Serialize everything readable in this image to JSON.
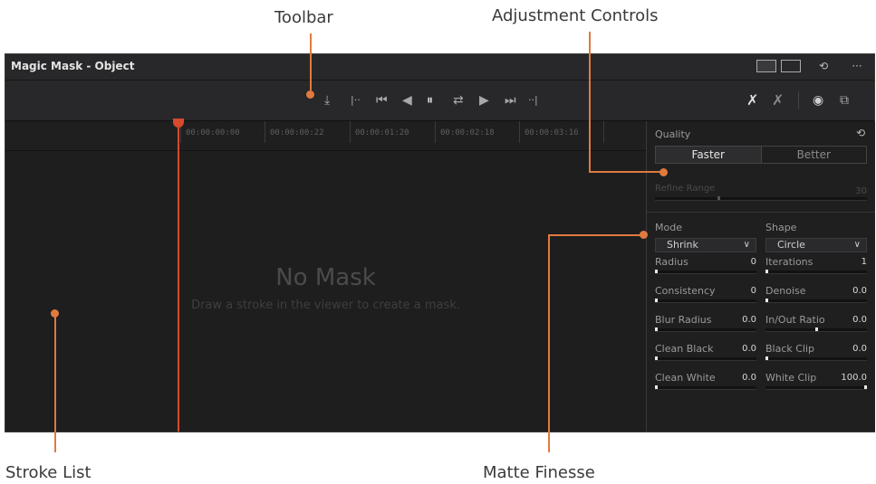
{
  "callouts": {
    "toolbar": "Toolbar",
    "adjustment_controls": "Adjustment Controls",
    "stroke_list": "Stroke List",
    "matte_finesse": "Matte Finesse"
  },
  "window": {
    "title": "Magic Mask - Object",
    "icons": [
      "viewer-mode-icon",
      "image-icon",
      "reset-icon",
      "more-icon"
    ],
    "reset_glyph": "⟲",
    "more_glyph": "···"
  },
  "toolbar": {
    "tools": [
      {
        "name": "track-frame-icon",
        "glyph": "⤓"
      },
      {
        "name": "track-backward-icon",
        "glyph": "|··"
      },
      {
        "name": "skip-to-start-icon",
        "glyph": "⏮"
      },
      {
        "name": "step-back-icon",
        "glyph": "◀"
      },
      {
        "name": "pause-icon",
        "glyph": "⏸"
      },
      {
        "name": "track-both-icon",
        "glyph": "⇄"
      },
      {
        "name": "play-forward-icon",
        "glyph": "▶"
      },
      {
        "name": "skip-to-end-icon",
        "glyph": "⏭"
      },
      {
        "name": "track-forward-icon",
        "glyph": "··|"
      }
    ],
    "right_tools": [
      {
        "name": "add-stroke-icon",
        "glyph": "✗"
      },
      {
        "name": "subtract-stroke-icon",
        "glyph": "✗"
      },
      {
        "name": "show-overlay-icon",
        "glyph": "◉"
      },
      {
        "name": "mask-display-icon",
        "glyph": "⧉"
      }
    ]
  },
  "timeline": {
    "timecodes": [
      "00:00:00:00",
      "00:00:00:22",
      "00:00:01:20",
      "00:00:02:18",
      "00:00:03:16"
    ],
    "empty_title": "No Mask",
    "empty_subtitle": "Draw a stroke in the viewer to create a mask."
  },
  "adjust": {
    "quality_label": "Quality",
    "quality_options": [
      "Faster",
      "Better"
    ],
    "quality_selected": "Faster",
    "refine_range_label": "Refine Range",
    "refine_range_value": "30",
    "refine_range_level": 0.3,
    "mode_label": "Mode",
    "mode_value": "Shrink",
    "shape_label": "Shape",
    "shape_value": "Circle",
    "params_left": [
      {
        "label": "Radius",
        "value": "0",
        "level": 0
      },
      {
        "label": "Consistency",
        "value": "0",
        "level": 0
      },
      {
        "label": "Blur Radius",
        "value": "0.0",
        "level": 0
      },
      {
        "label": "Clean Black",
        "value": "0.0",
        "level": 0
      },
      {
        "label": "Clean White",
        "value": "0.0",
        "level": 0
      }
    ],
    "params_right": [
      {
        "label": "Iterations",
        "value": "1",
        "level": 0
      },
      {
        "label": "Denoise",
        "value": "0.0",
        "level": 0
      },
      {
        "label": "In/Out Ratio",
        "value": "0.0",
        "level": 0.5
      },
      {
        "label": "Black Clip",
        "value": "0.0",
        "level": 0
      },
      {
        "label": "White Clip",
        "value": "100.0",
        "level": 1
      }
    ]
  }
}
